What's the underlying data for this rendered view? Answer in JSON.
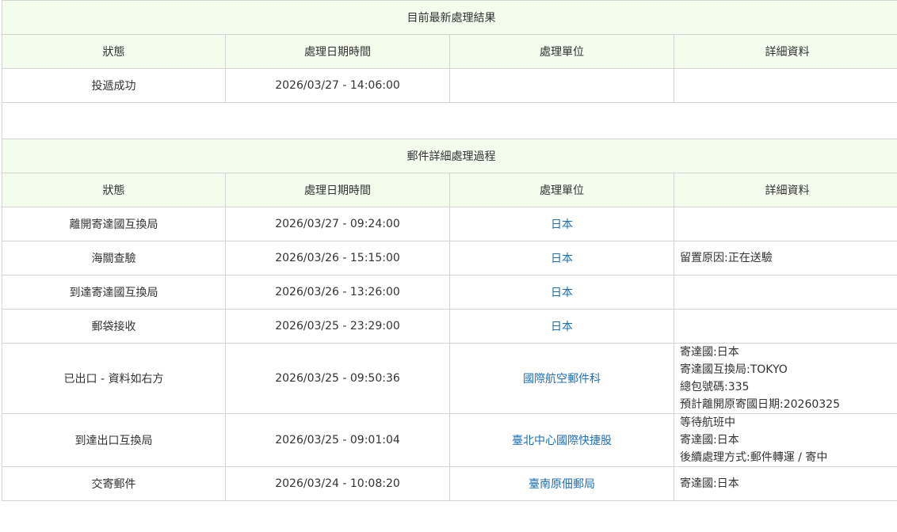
{
  "latest": {
    "title": "目前最新處理結果",
    "headers": [
      "狀態",
      "處理日期時間",
      "處理單位",
      "詳細資料"
    ],
    "row": {
      "status": "投遞成功",
      "datetime": "2026/03/27 - 14:06:00",
      "unit": "",
      "details": []
    }
  },
  "history": {
    "title": "郵件詳細處理過程",
    "headers": [
      "狀態",
      "處理日期時間",
      "處理單位",
      "詳細資料"
    ],
    "rows": [
      {
        "status": "離開寄達國互換局",
        "datetime": "2026/03/27 - 09:24:00",
        "unit": "日本",
        "details": []
      },
      {
        "status": "海關查驗",
        "datetime": "2026/03/26 - 15:15:00",
        "unit": "日本",
        "details": [
          "留置原因:正在送驗"
        ]
      },
      {
        "status": "到達寄達國互換局",
        "datetime": "2026/03/26 - 13:26:00",
        "unit": "日本",
        "details": []
      },
      {
        "status": "郵袋接收",
        "datetime": "2026/03/25 - 23:29:00",
        "unit": "日本",
        "details": []
      },
      {
        "status": "已出口 - 資料如右方",
        "datetime": "2026/03/25 - 09:50:36",
        "unit": "國際航空郵件科",
        "details": [
          "寄達國:日本",
          "寄達國互換局:TOKYO",
          "總包號碼:335",
          "預計離開原寄國日期:20260325"
        ]
      },
      {
        "status": "到達出口互換局",
        "datetime": "2026/03/25 - 09:01:04",
        "unit": "臺北中心國際快捷股",
        "details": [
          "等待航班中",
          "寄達國:日本",
          "後續處理方式:郵件轉運 / 寄中"
        ]
      },
      {
        "status": "交寄郵件",
        "datetime": "2026/03/24 - 10:08:20",
        "unit": "臺南原佃郵局",
        "details": [
          "寄達國:日本"
        ]
      }
    ]
  },
  "colors": {
    "header_bg": "#f3fced",
    "border": "#d4d4d4",
    "link": "#1c6fb8",
    "text": "#333333"
  }
}
